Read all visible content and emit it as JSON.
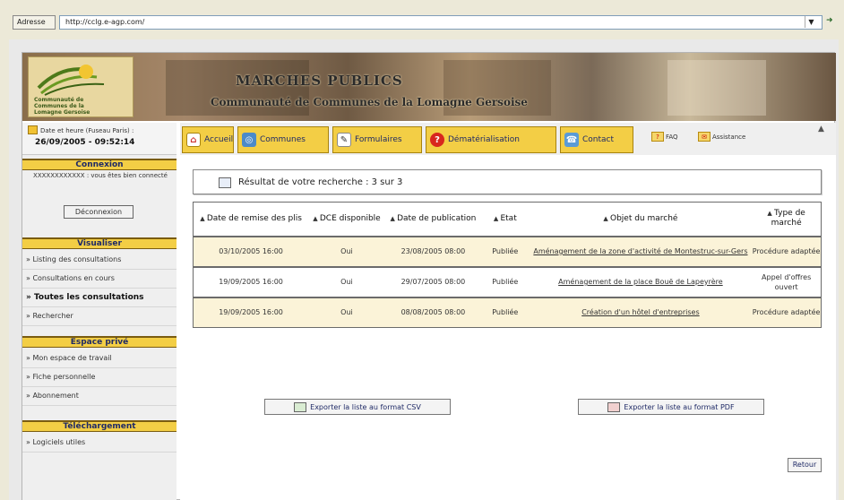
{
  "browser": {
    "address_label": "Adresse",
    "url": "http://cclg.e-agp.com/"
  },
  "banner": {
    "title": "MARCHES PUBLICS",
    "subtitle": "Communauté de Communes de la Lomagne Gersoise",
    "logo_text": "Communauté de Communes de la Lomagne Gersoise"
  },
  "datetime": {
    "label": "Date et heure (Fuseau Paris) :",
    "value": "26/09/2005 - 09:52:14"
  },
  "nav": {
    "items": [
      {
        "label": "Accueil",
        "icon": "home-icon"
      },
      {
        "label": "Communes",
        "icon": "communes-icon"
      },
      {
        "label": "Formulaires",
        "icon": "form-icon"
      },
      {
        "label": "Dématérialisation",
        "icon": "dematerialisation-icon"
      },
      {
        "label": "Contact",
        "icon": "contact-icon"
      }
    ],
    "faq": "FAQ",
    "assistance": "Assistance"
  },
  "sidebar": {
    "connexion": {
      "header": "Connexion",
      "text": "XXXXXXXXXXXX : vous êtes bien connecté",
      "button": "Déconnexion"
    },
    "visualiser": {
      "header": "Visualiser",
      "items": [
        "» Listing des consultations",
        "» Consultations en cours",
        "» Toutes les consultations",
        "» Rechercher"
      ]
    },
    "espace": {
      "header": "Espace privé",
      "items": [
        "» Mon espace de travail",
        "» Fiche personnelle",
        "» Abonnement"
      ]
    },
    "telechargement": {
      "header": "Téléchargement",
      "items": [
        "» Logiciels utiles"
      ]
    }
  },
  "main": {
    "result_text": "Résultat de votre recherche : 3 sur 3",
    "columns": [
      "Date de remise des plis",
      "DCE disponible",
      "Date de publication",
      "Etat",
      "Objet du marché",
      "Type de marché"
    ],
    "rows": [
      {
        "date_remise": "03/10/2005 16:00",
        "dce": "Oui",
        "date_pub": "23/08/2005 08:00",
        "etat": "Publiée",
        "objet": "Aménagement de la zone d'activité de Montestruc-sur-Gers",
        "type": "Procédure adaptée"
      },
      {
        "date_remise": "19/09/2005 16:00",
        "dce": "Oui",
        "date_pub": "29/07/2005 08:00",
        "etat": "Publiée",
        "objet": "Aménagement de la place Bouë de Lapeyrère",
        "type": "Appel d'offres ouvert"
      },
      {
        "date_remise": "19/09/2005 16:00",
        "dce": "Oui",
        "date_pub": "08/08/2005 08:00",
        "etat": "Publiée",
        "objet": "Création d'un hôtel d'entreprises",
        "type": "Procédure adaptée"
      }
    ],
    "export_csv": "Exporter la liste au format CSV",
    "export_pdf": "Exporter la liste au format PDF",
    "retour": "Retour"
  },
  "colors": {
    "accent_yellow": "#f3ce45",
    "nav_text": "#1f2a66",
    "row_alt": "#fbf3d8",
    "oui_green": "#3d9b3d"
  }
}
